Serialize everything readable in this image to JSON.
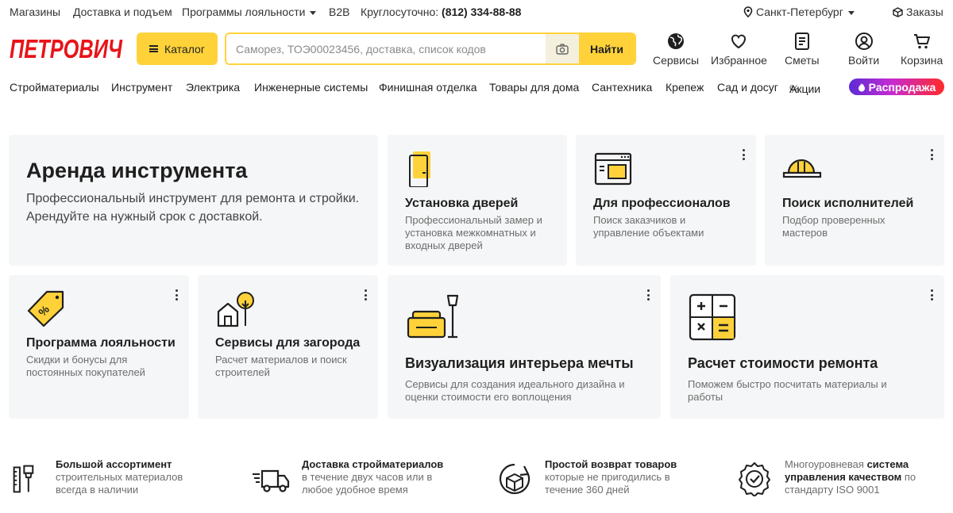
{
  "topbar": {
    "stores": "Магазины",
    "delivery": "Доставка и подъем",
    "loyalty": "Программы лояльности",
    "b2b": "B2B",
    "phone_label": "Круглосуточно:",
    "phone": "(812) 334-88-88",
    "city": "Санкт-Петербург",
    "orders": "Заказы"
  },
  "header": {
    "logo_text": "ПЕТРОВИЧ",
    "catalog_label": "Каталог",
    "search_placeholder": "Саморез, ТОЭ00023456, доставка, список кодов",
    "search_button": "Найти",
    "items": [
      {
        "label": "Сервисы",
        "icon": "globe-icon"
      },
      {
        "label": "Избранное",
        "icon": "heart-icon"
      },
      {
        "label": "Сметы",
        "icon": "document-icon"
      },
      {
        "label": "Войти",
        "icon": "user-icon"
      },
      {
        "label": "Корзина",
        "icon": "cart-icon"
      }
    ]
  },
  "categories": [
    "Стройматериалы",
    "Инструмент",
    "Электрика",
    "Инженерные системы",
    "Финишная отделка",
    "Товары для дома",
    "Сантехника",
    "Крепеж",
    "Сад и досуг",
    "Акции"
  ],
  "sale_label": "Распродажа",
  "hero": {
    "title": "Аренда инструмента",
    "subtitle": "Профессиональный инструмент для ремонта и стройки. Арендуйте на нужный срок с доставкой."
  },
  "cards": [
    {
      "title": "Установка дверей",
      "desc": "Профессиональный замер и установка межкомнатных и входных дверей",
      "icon": "door-icon"
    },
    {
      "title": "Для профессионалов",
      "desc": "Поиск заказчиков и управление объектами",
      "icon": "browser-window-icon"
    },
    {
      "title": "Поиск исполнителей",
      "desc": "Подбор проверенных мастеров",
      "icon": "hard-hat-icon"
    },
    {
      "title": "Программа лояльности",
      "desc": "Скидки и бонусы для постоянных покупателей",
      "icon": "discount-tag-icon"
    },
    {
      "title": "Сервисы для загорода",
      "desc": "Расчет материалов и поиск строителей",
      "icon": "house-tree-icon"
    },
    {
      "title": "Визуализация интерьера мечты",
      "desc": "Сервисы для создания идеального дизайна и оценки стоимости его воплощения",
      "icon": "sofa-lamp-icon"
    },
    {
      "title": "Расчет стоимости ремонта",
      "desc": "Поможем быстро посчитать материалы и работы",
      "icon": "calculator-icon"
    }
  ],
  "features": [
    {
      "bold": "Большой ассортимент",
      "text": "строительных материалов всегда в наличии",
      "icon": "tools-icon"
    },
    {
      "bold": "Доставка стройматериалов",
      "text": "в течение двух часов или в любое удобное время",
      "icon": "delivery-truck-icon"
    },
    {
      "bold": "Простой возврат товаров",
      "text": "которые не пригодились в течение 360 дней",
      "icon": "return-box-icon"
    },
    {
      "pre": "Многоуровневая",
      "bold": "система управления качеством",
      "text": "по стандарту ISO 9001",
      "icon": "quality-badge-icon"
    }
  ],
  "colors": {
    "accent": "#ffd23a",
    "brand": "#e8141a",
    "card_bg": "#f5f6f7"
  }
}
